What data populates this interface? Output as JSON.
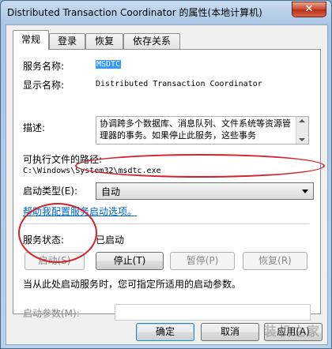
{
  "window": {
    "title": "Distributed Transaction Coordinator 的属性(本地计算机)",
    "close_glyph": "✕"
  },
  "tabs": [
    {
      "label": "常规",
      "active": true
    },
    {
      "label": "登录",
      "active": false
    },
    {
      "label": "恢复",
      "active": false
    },
    {
      "label": "依存关系",
      "active": false
    }
  ],
  "general": {
    "service_name_label": "服务名称:",
    "service_name_value": "MSDTC",
    "display_name_label": "显示名称:",
    "display_name_value": "Distributed Transaction Coordinator",
    "description_label": "描述:",
    "description_value": "协调跨多个数据库、消息队列、文件系统等资源管理器的事务。如果停止此服务，这些事务",
    "path_label": "可执行文件的路径:",
    "path_value": "C:\\Windows\\System32\\msdtc.exe",
    "startup_type_label": "启动类型(E):",
    "startup_type_value": "自动",
    "help_link": "帮助我配置服务启动选项。",
    "status_label": "服务状态:",
    "status_value": "已启动",
    "start_button": "启动(S)",
    "stop_button": "停止(T)",
    "pause_button": "暂停(P)",
    "resume_button": "恢复(R)",
    "hint_text": "当从此处启动服务时，您可指定所适用的启动参数。",
    "start_params_label": "启动参数(M):",
    "start_params_value": ""
  },
  "footer": {
    "ok_button": "确定",
    "cancel_button": "取消",
    "apply_button": "应用(A)"
  },
  "watermark": "装机之家",
  "colors": {
    "highlight": "#3399ff",
    "annotation_ring": "#d2222c",
    "link": "#0066cc"
  }
}
